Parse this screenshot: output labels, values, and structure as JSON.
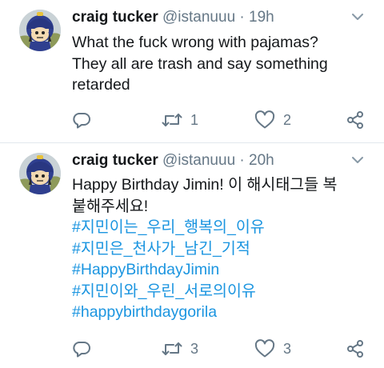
{
  "tweets": [
    {
      "author_name": "craig tucker",
      "handle": "@istanuuu",
      "separator": "·",
      "time": "19h",
      "text_lines": [
        "What the fuck wrong with pajamas?",
        "They all are trash and say something",
        "retarded"
      ],
      "hashtags": [],
      "retweet_count": "1",
      "like_count": "2"
    },
    {
      "author_name": "craig tucker",
      "handle": "@istanuuu",
      "separator": "·",
      "time": "20h",
      "text_lines": [
        "Happy Birthday Jimin! 이 해시태그들 복",
        "붙해주세요!"
      ],
      "hashtags": [
        "#지민이는_우리_행복의_이유",
        "#지민은_천사가_남긴_기적",
        "#HappyBirthdayJimin",
        "#지민이와_우린_서로의이유",
        "#happybirthdaygorila"
      ],
      "retweet_count": "3",
      "like_count": "3"
    }
  ],
  "icons": {
    "reply": "reply-icon",
    "retweet": "retweet-icon",
    "like": "heart-icon",
    "share": "share-icon",
    "caret": "chevron-down-icon"
  },
  "colors": {
    "hashtag": "#1b95e0",
    "secondary_text": "#657786",
    "primary_text": "#14171a",
    "divider": "#e1e8ed"
  }
}
